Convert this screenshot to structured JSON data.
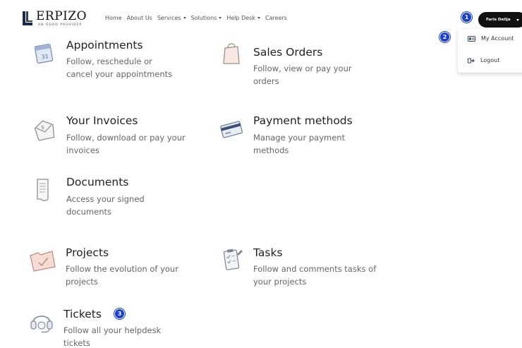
{
  "header": {
    "logo_text": "ERPIZO",
    "logo_tagline": "AN ODOO PROVIDER",
    "nav": [
      {
        "label": "Home",
        "has_caret": false
      },
      {
        "label": "About Us",
        "has_caret": false
      },
      {
        "label": "Services",
        "has_caret": true
      },
      {
        "label": "Solutions",
        "has_caret": true
      },
      {
        "label": "Help Desk",
        "has_caret": true
      },
      {
        "label": "Careers",
        "has_caret": false
      }
    ],
    "user_name": "Faris Delija"
  },
  "dropdown": {
    "my_account": "My Account",
    "logout": "Logout"
  },
  "badges": {
    "one": "1",
    "two": "2",
    "three": "3"
  },
  "tiles": {
    "appointments": {
      "title": "Appointments",
      "desc": "Follow, reschedule or cancel your appointments"
    },
    "sales_orders": {
      "title": "Sales Orders",
      "desc": "Follow, view or pay your orders"
    },
    "invoices": {
      "title": "Your Invoices",
      "desc": "Follow, download or pay your invoices"
    },
    "payment_methods": {
      "title": "Payment methods",
      "desc": "Manage your payment methods"
    },
    "documents": {
      "title": "Documents",
      "desc": "Access your signed documents"
    },
    "projects": {
      "title": "Projects",
      "desc": "Follow the evolution of your projects"
    },
    "tasks": {
      "title": "Tasks",
      "desc": "Follow and comments tasks of your projects"
    },
    "tickets": {
      "title": "Tickets",
      "desc": "Follow all your helpdesk tickets"
    }
  },
  "colors": {
    "accent_badge": "#1a3fd8",
    "user_button": "#111111"
  }
}
